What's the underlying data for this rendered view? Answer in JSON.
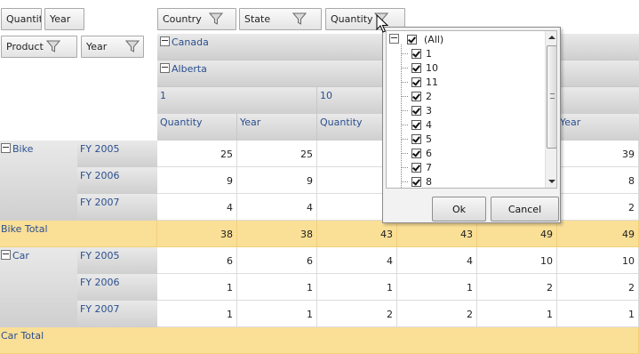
{
  "filter_area": {
    "top_fields": [
      "Quantit",
      "Year"
    ],
    "column_fields": [
      "Country",
      "State",
      "Quantity"
    ],
    "row_fields": [
      "Product",
      "Year"
    ]
  },
  "column_headers": {
    "country": "Canada",
    "state": "Alberta",
    "quantity_values": [
      "1",
      "10"
    ],
    "data_headers": [
      "Quantity",
      "Year",
      "Quantity",
      "Year"
    ]
  },
  "rows": [
    {
      "product": "Bike",
      "year": "FY 2005",
      "values": [
        "25",
        "25",
        "",
        "",
        "",
        "39"
      ]
    },
    {
      "product": "",
      "year": "FY 2006",
      "values": [
        "9",
        "9",
        "",
        "",
        "",
        "8"
      ]
    },
    {
      "product": "",
      "year": "FY 2007",
      "values": [
        "4",
        "4",
        "",
        "",
        "",
        "2"
      ]
    },
    {
      "total": "Bike Total",
      "values": [
        "38",
        "38",
        "43",
        "43",
        "49",
        "49"
      ]
    },
    {
      "product": "Car",
      "year": "FY 2005",
      "values": [
        "6",
        "6",
        "4",
        "4",
        "10",
        "10"
      ]
    },
    {
      "product": "",
      "year": "FY 2006",
      "values": [
        "1",
        "1",
        "1",
        "1",
        "2",
        "2"
      ]
    },
    {
      "product": "",
      "year": "FY 2007",
      "values": [
        "1",
        "1",
        "2",
        "2",
        "1",
        "1"
      ]
    },
    {
      "total": "Car Total"
    }
  ],
  "filter_popup": {
    "all_label": "(All)",
    "items": [
      "1",
      "10",
      "11",
      "2",
      "3",
      "4",
      "5",
      "6",
      "7",
      "8"
    ],
    "ok_label": "Ok",
    "cancel_label": "Cancel"
  },
  "colors": {
    "total_row": "#fadf97",
    "header_text": "#2a4f8f",
    "grid_line": "#dcdcdc"
  },
  "icons": [
    "funnel-icon",
    "collapse-minus-icon",
    "checkbox-checked-icon",
    "scroll-up-icon",
    "scroll-down-icon",
    "mouse-cursor-icon"
  ]
}
